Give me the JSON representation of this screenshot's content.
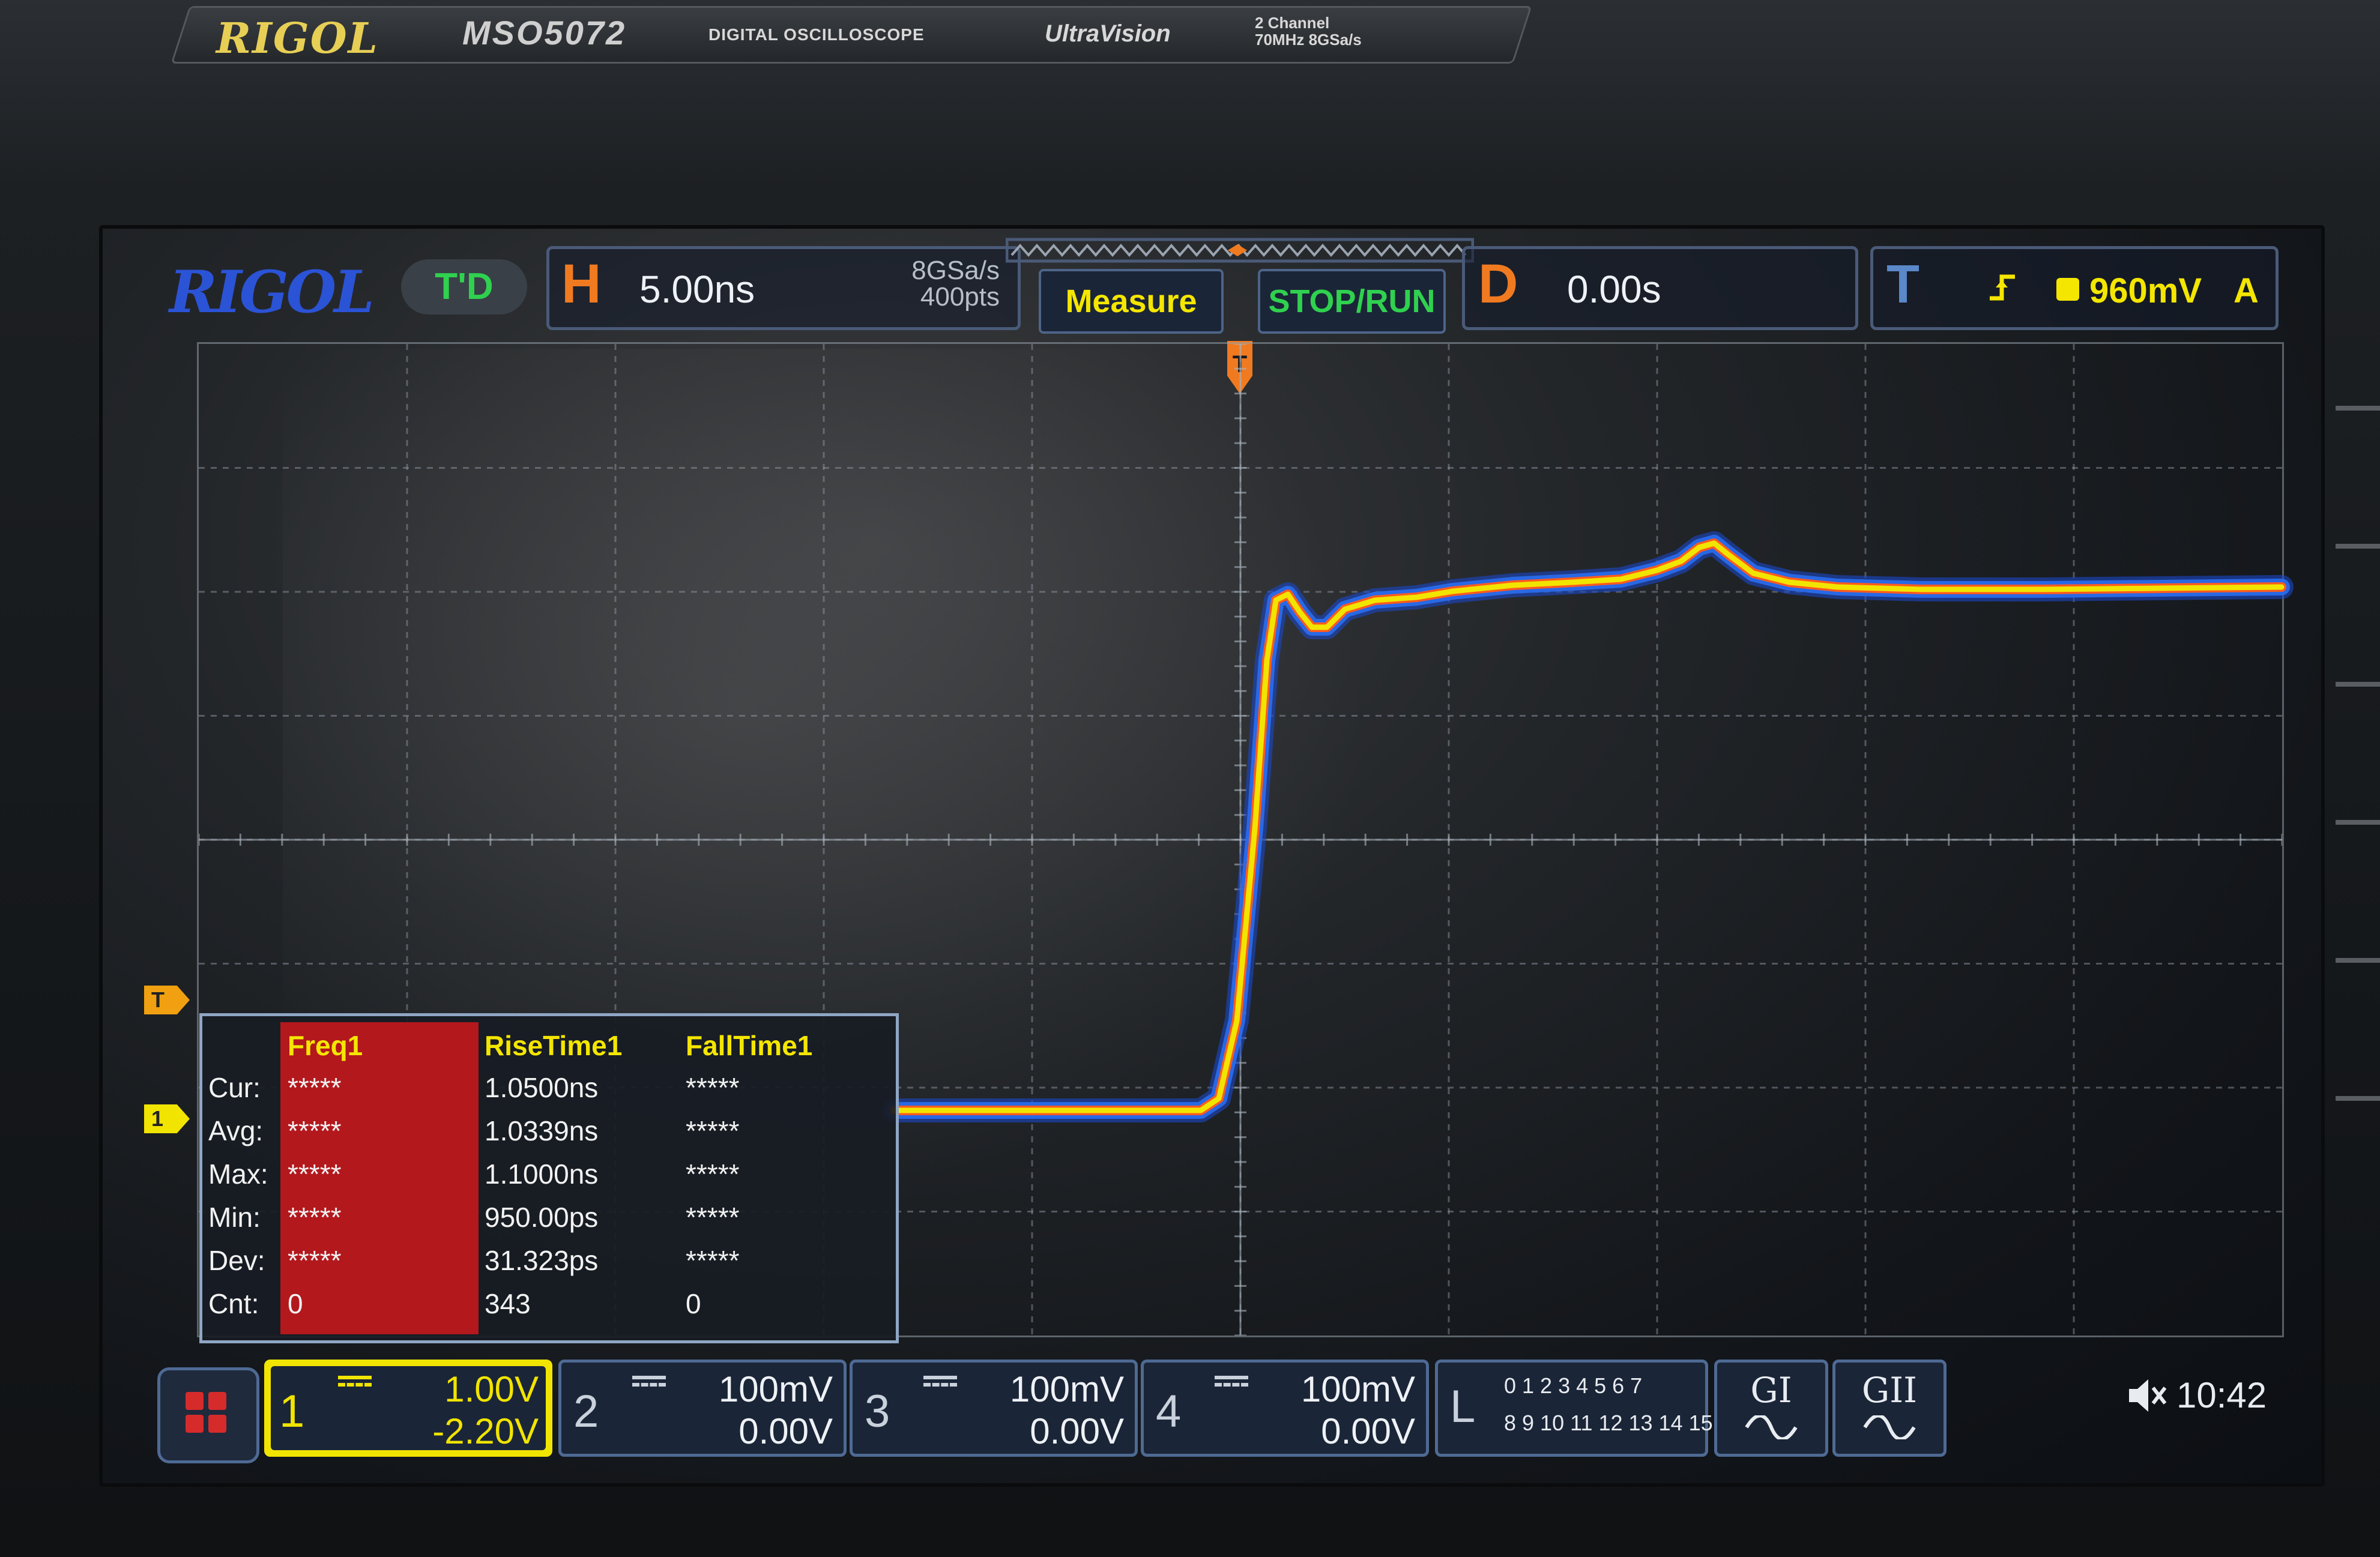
{
  "bezel": {
    "logo": "RIGOL",
    "model": "MSO5072",
    "description": "DIGITAL OSCILLOSCOPE",
    "series": "UltraVision",
    "channels_line1": "2 Channel",
    "channels_line2": "70MHz 8GSa/s"
  },
  "header": {
    "logo": "RIGOL",
    "mode": "T'D",
    "horizontal": {
      "letter": "H",
      "timebase": "5.00ns",
      "sample_rate": "8GSa/s",
      "points": "400pts"
    },
    "measure_button": "Measure",
    "stop_run_button": "STOP/RUN",
    "delay": {
      "letter": "D",
      "value": "0.00s"
    },
    "trigger": {
      "letter": "T",
      "level": "960mV",
      "mode": "A"
    }
  },
  "markers": {
    "trigger_level": "T",
    "channel1": "1"
  },
  "measurements": {
    "headers": [
      "Freq1",
      "RiseTime1",
      "FallTime1"
    ],
    "rows": [
      {
        "label": "Cur:",
        "values": [
          "*****",
          "1.0500ns",
          "*****"
        ]
      },
      {
        "label": "Avg:",
        "values": [
          "*****",
          "1.0339ns",
          "*****"
        ]
      },
      {
        "label": "Max:",
        "values": [
          "*****",
          "1.1000ns",
          "*****"
        ]
      },
      {
        "label": "Min:",
        "values": [
          "*****",
          "950.00ps",
          "*****"
        ]
      },
      {
        "label": "Dev:",
        "values": [
          "*****",
          "31.323ps",
          "*****"
        ]
      },
      {
        "label": "Cnt:",
        "values": [
          "0",
          "343",
          "0"
        ]
      }
    ]
  },
  "channels": [
    {
      "num": "1",
      "scale": "1.00V",
      "offset": "-2.20V",
      "color": "#f1e400"
    },
    {
      "num": "2",
      "scale": "100mV",
      "offset": "0.00V",
      "color": "#c9d1dc"
    },
    {
      "num": "3",
      "scale": "100mV",
      "offset": "0.00V",
      "color": "#c9d1dc"
    },
    {
      "num": "4",
      "scale": "100mV",
      "offset": "0.00V",
      "color": "#c9d1dc"
    }
  ],
  "logic": {
    "label": "L",
    "row1": "0 1 2 3  4 5 6 7",
    "row2": "8 9 10 11 12 13 14 15"
  },
  "generators": [
    "GI",
    "GII"
  ],
  "status": {
    "time": "10:42"
  },
  "waveform": {
    "color": "#f1e400",
    "glow": "#2a6ef0"
  }
}
